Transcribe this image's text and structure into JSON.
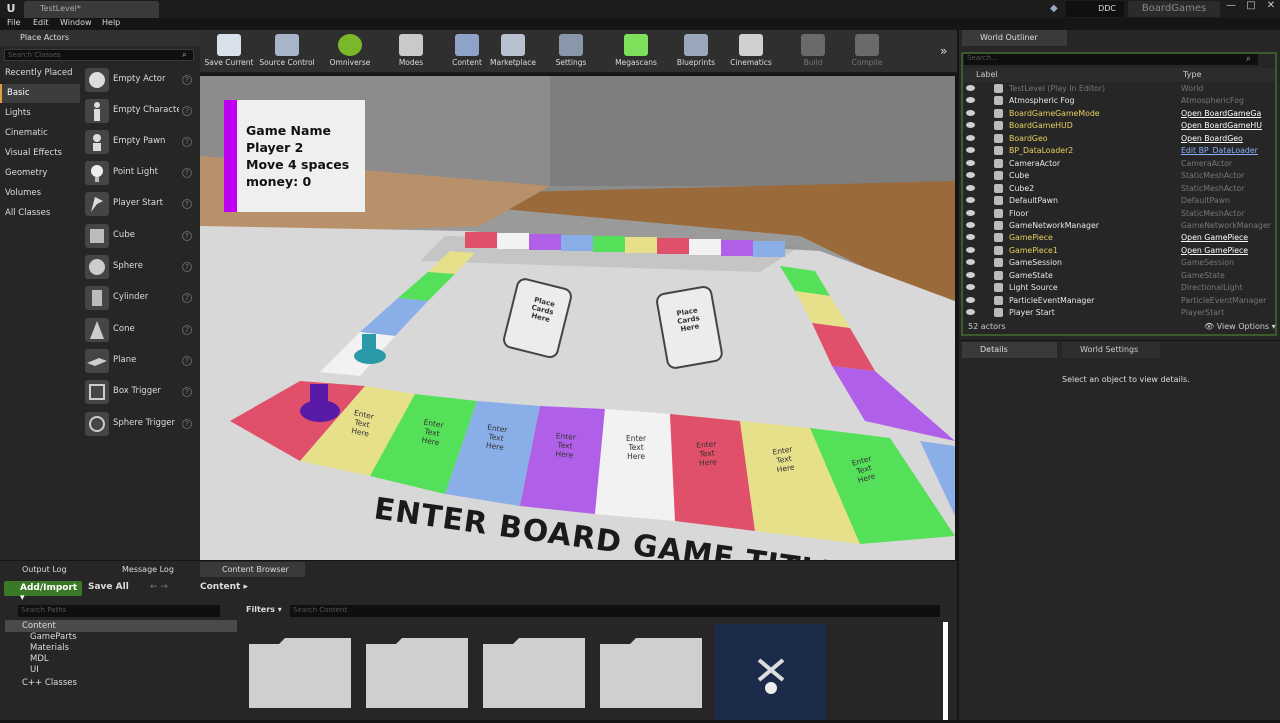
{
  "titlebar": {
    "doc_tab": "TestLevel*",
    "ddc": "DDC",
    "project": "BoardGames",
    "minimize": "—",
    "maximize": "□",
    "close": "✕"
  },
  "menu": [
    "File",
    "Edit",
    "Window",
    "Help"
  ],
  "place_actors": {
    "tab": "Place Actors",
    "search_placeholder": "Search Classes",
    "categories": [
      "Recently Placed",
      "Basic",
      "Lights",
      "Cinematic",
      "Visual Effects",
      "Geometry",
      "Volumes",
      "All Classes"
    ],
    "selected_category": "Basic",
    "items": [
      "Empty Actor",
      "Empty Characte",
      "Empty Pawn",
      "Point Light",
      "Player Start",
      "Cube",
      "Sphere",
      "Cylinder",
      "Cone",
      "Plane",
      "Box Trigger",
      "Sphere Trigger"
    ]
  },
  "toolbar": [
    "Save Current",
    "Source Control",
    "Omniverse",
    "Modes",
    "Content",
    "Marketplace",
    "Settings",
    "Megascans",
    "Blueprints",
    "Cinematics",
    "Build",
    "Compile"
  ],
  "viewport": {
    "hud": {
      "line1": "Game Name",
      "line2": "Player 2",
      "line3": "Move 4 spaces",
      "line4": "money: 0"
    },
    "card_text": "Place\nCards\nHere",
    "tile_text": "Enter\nText\nHere",
    "board_title": "ENTER BOARD GAME TITLE",
    "colors": {
      "red": "#e0506a",
      "yellow": "#e6e08a",
      "green": "#55e05a",
      "blue": "#8aaee8",
      "purple": "#b060e8",
      "white": "#f2f2f2"
    }
  },
  "outliner": {
    "tab": "World Outliner",
    "search_placeholder": "Search...",
    "col_label": "Label",
    "col_type": "Type",
    "rows": [
      {
        "label": "TestLevel (Play In Editor)",
        "type": "World",
        "style": "muted"
      },
      {
        "label": "Atmospheric Fog",
        "type": "AtmosphericFog",
        "style": "normal"
      },
      {
        "label": "BoardGameGameMode",
        "type": "Open BoardGameGa",
        "style": "link"
      },
      {
        "label": "BoardGameHUD",
        "type": "Open BoardGameHU",
        "style": "link"
      },
      {
        "label": "BoardGeo",
        "type": "Open BoardGeo",
        "style": "link"
      },
      {
        "label": "BP_DataLoader2",
        "type": "Edit BP_DataLoader",
        "style": "blue"
      },
      {
        "label": "CameraActor",
        "type": "CameraActor",
        "style": "normal"
      },
      {
        "label": "Cube",
        "type": "StaticMeshActor",
        "style": "normal"
      },
      {
        "label": "Cube2",
        "type": "StaticMeshActor",
        "style": "normal"
      },
      {
        "label": "DefaultPawn",
        "type": "DefaultPawn",
        "style": "normal"
      },
      {
        "label": "Floor",
        "type": "StaticMeshActor",
        "style": "normal"
      },
      {
        "label": "GameNetworkManager",
        "type": "GameNetworkManager",
        "style": "normal"
      },
      {
        "label": "GamePiece",
        "type": "Open GamePiece",
        "style": "link"
      },
      {
        "label": "GamePiece1",
        "type": "Open GamePiece",
        "style": "link"
      },
      {
        "label": "GameSession",
        "type": "GameSession",
        "style": "normal"
      },
      {
        "label": "GameState",
        "type": "GameState",
        "style": "normal"
      },
      {
        "label": "Light Source",
        "type": "DirectionalLight",
        "style": "normal"
      },
      {
        "label": "ParticleEventManager",
        "type": "ParticleEventManager",
        "style": "normal"
      },
      {
        "label": "Player Start",
        "type": "PlayerStart",
        "style": "normal"
      }
    ],
    "count": "52 actors",
    "view_options": "View Options"
  },
  "details": {
    "tab": "Details",
    "world_settings_tab": "World Settings",
    "message": "Select an object to view details."
  },
  "bottom": {
    "tabs": [
      "Output Log",
      "Message Log",
      "Content Browser"
    ],
    "add_import": "Add/Import",
    "save_all": "Save All",
    "crumb": "Content",
    "paths_placeholder": "Search Paths",
    "filters": "Filters",
    "content_placeholder": "Search Content",
    "tree": [
      "Content",
      "GameParts",
      "Materials",
      "MDL",
      "UI",
      "C++ Classes"
    ]
  }
}
